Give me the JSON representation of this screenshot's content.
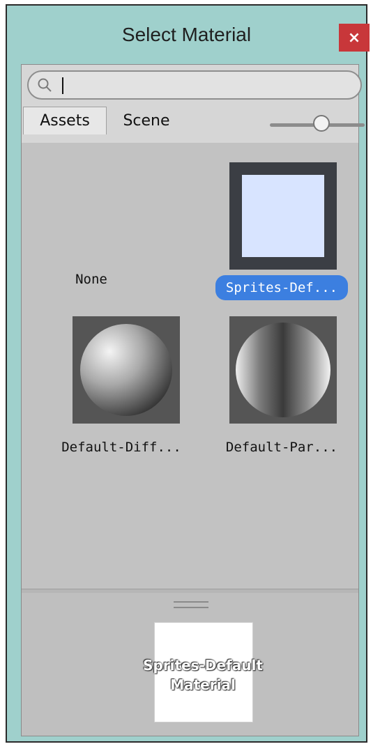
{
  "window": {
    "title": "Select Material",
    "close_glyph": "×"
  },
  "search": {
    "value": "",
    "placeholder": ""
  },
  "tabs": [
    {
      "label": "Assets",
      "active": true
    },
    {
      "label": "Scene",
      "active": false
    }
  ],
  "zoom_slider": {
    "value_fraction": 0.6
  },
  "items": [
    {
      "label": "None",
      "selected": false,
      "thumbnail": "none"
    },
    {
      "label": "Sprites-Def...",
      "selected": true,
      "thumbnail": "sprite-square"
    },
    {
      "label": "Default-Diff...",
      "selected": false,
      "thumbnail": "diffuse-sphere"
    },
    {
      "label": "Default-Par...",
      "selected": false,
      "thumbnail": "particle-sphere"
    }
  ],
  "preview": {
    "caption_line1": "Sprites-Default",
    "caption_line2": "Material"
  },
  "colors": {
    "window_frame": "#9fd0cc",
    "close_button": "#c8373a",
    "selection": "#3c7fe0"
  }
}
